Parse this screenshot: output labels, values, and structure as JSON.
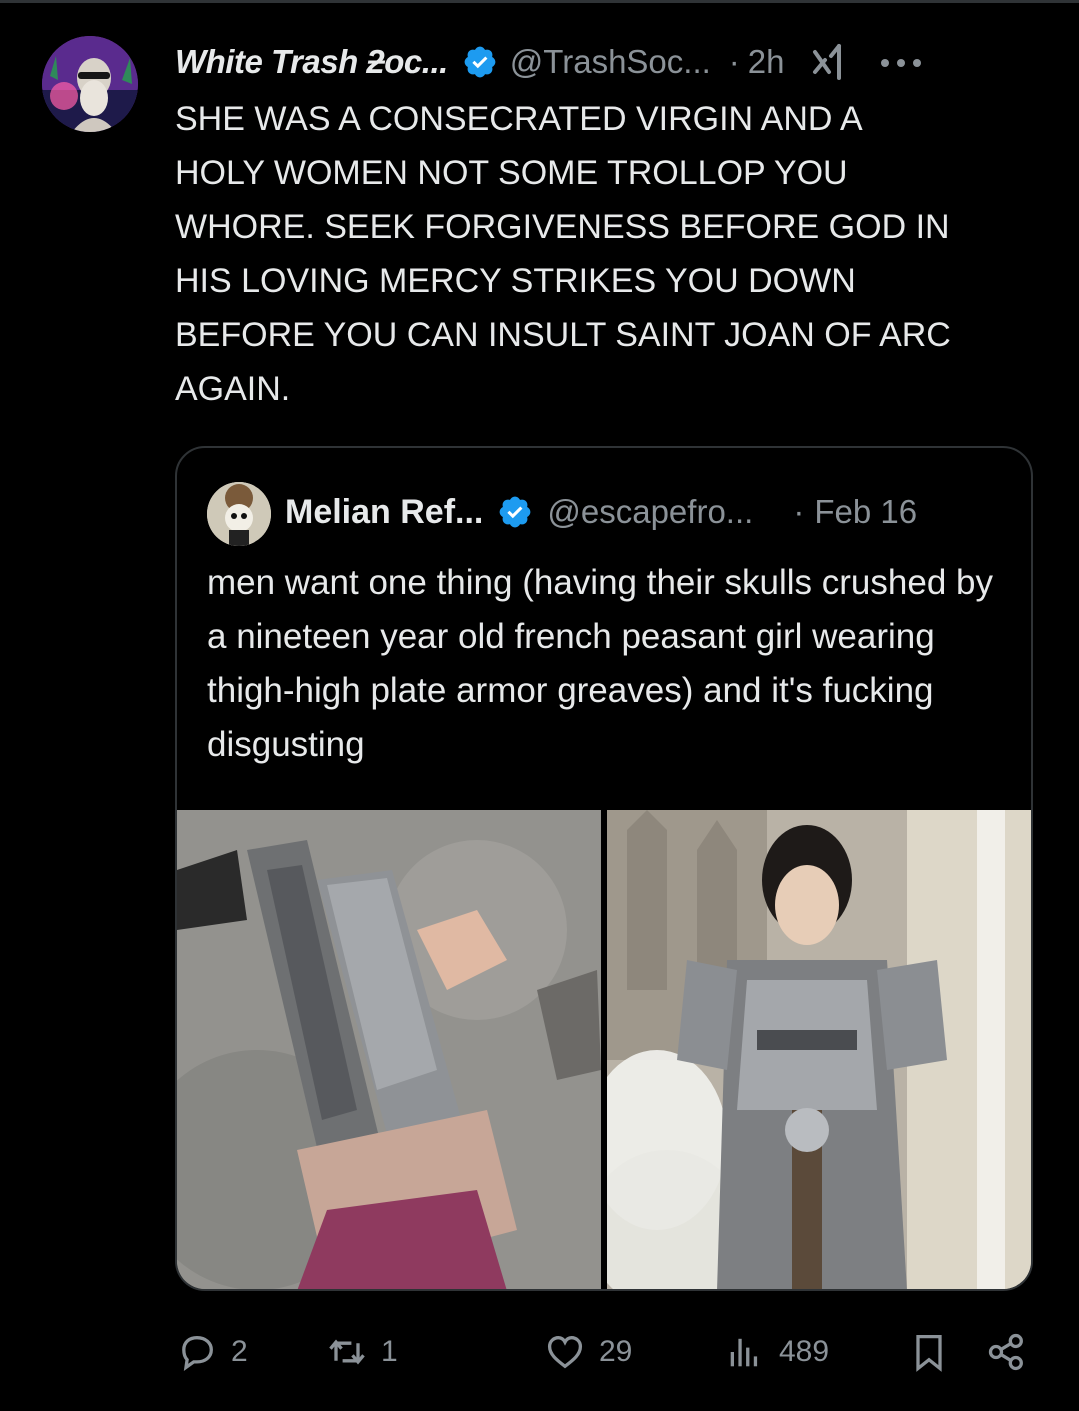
{
  "tweet": {
    "author": {
      "display_name": "White Trash ƻoc...",
      "handle": "@TrashSoc...",
      "verified": true
    },
    "separator": "·",
    "time": "2h",
    "text": "SHE WAS A CONSECRATED VIRGIN AND A\nHOLY WOMEN NOT SOME TROLLOP YOU\nWHORE. SEEK FORGIVENESS BEFORE GOD IN\nHIS LOVING MERCY  STRIKES YOU DOWN\nBEFORE YOU CAN INSULT SAINT JOAN OF ARC\nAGAIN.",
    "icons": {
      "grok": "grok-icon",
      "more": "more-icon"
    }
  },
  "quoted": {
    "author": {
      "display_name": "Melian Ref...",
      "handle": "@escapefro...",
      "verified": true
    },
    "separator": "·",
    "date": "Feb 16",
    "text": "men want one thing (having their skulls crushed by a nineteen year old french peasant girl wearing thigh-high plate armor greaves) and it's fucking disgusting",
    "media": [
      {
        "name": "photo-greaves",
        "icon": "photo"
      },
      {
        "name": "painting-joan-of-arc",
        "icon": "photo"
      }
    ]
  },
  "actions": {
    "reply_count": "2",
    "repost_count": "1",
    "like_count": "29",
    "views_count": "489"
  },
  "colors": {
    "background": "#000000",
    "text": "#e7e9ea",
    "secondary": "#8b9298",
    "border": "#2f3336",
    "verified": "#1d9bf0"
  }
}
